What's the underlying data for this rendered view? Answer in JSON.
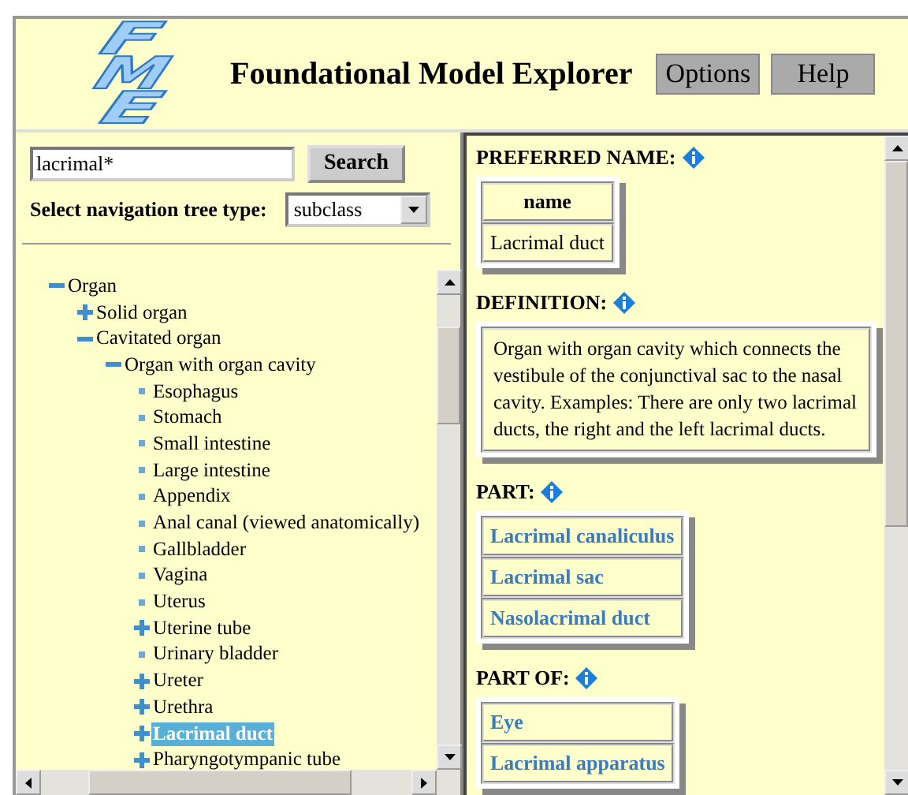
{
  "header": {
    "logo_letters": [
      "F",
      "M",
      "E"
    ],
    "title": "Foundational Model Explorer",
    "buttons": [
      "Options",
      "Help"
    ]
  },
  "search": {
    "value": "lacrimal*",
    "button": "Search",
    "tree_type_label": "Select navigation tree type:",
    "tree_type": "subclass"
  },
  "tree": [
    {
      "label": "Organ",
      "kind": "expanded",
      "selected": false,
      "children": [
        {
          "label": "Solid organ",
          "kind": "collapsed",
          "selected": false
        },
        {
          "label": "Cavitated organ",
          "kind": "expanded",
          "selected": false,
          "children": [
            {
              "label": "Organ with organ cavity",
              "kind": "expanded",
              "selected": false,
              "children": [
                {
                  "label": "Esophagus",
                  "kind": "leaf",
                  "selected": false
                },
                {
                  "label": "Stomach",
                  "kind": "leaf",
                  "selected": false
                },
                {
                  "label": "Small intestine",
                  "kind": "leaf",
                  "selected": false
                },
                {
                  "label": "Large intestine",
                  "kind": "leaf",
                  "selected": false
                },
                {
                  "label": "Appendix",
                  "kind": "leaf",
                  "selected": false
                },
                {
                  "label": "Anal canal (viewed anatomically)",
                  "kind": "leaf",
                  "selected": false
                },
                {
                  "label": "Gallbladder",
                  "kind": "leaf",
                  "selected": false
                },
                {
                  "label": "Vagina",
                  "kind": "leaf",
                  "selected": false
                },
                {
                  "label": "Uterus",
                  "kind": "leaf",
                  "selected": false
                },
                {
                  "label": "Uterine tube",
                  "kind": "collapsed",
                  "selected": false
                },
                {
                  "label": "Urinary bladder",
                  "kind": "leaf",
                  "selected": false
                },
                {
                  "label": "Ureter",
                  "kind": "collapsed",
                  "selected": false
                },
                {
                  "label": "Urethra",
                  "kind": "collapsed",
                  "selected": false
                },
                {
                  "label": "Lacrimal duct",
                  "kind": "collapsed",
                  "selected": true
                },
                {
                  "label": "Pharyngotympanic tube",
                  "kind": "collapsed",
                  "selected": false
                }
              ]
            }
          ]
        }
      ]
    }
  ],
  "details": [
    {
      "heading": "PREFERRED NAME:",
      "kind": "table",
      "column": "name",
      "rows": [
        "Lacrimal duct"
      ]
    },
    {
      "heading": "DEFINITION:",
      "kind": "text",
      "text": "Organ with organ cavity which connects the vestibule of the conjunctival sac to the nasal cavity. Examples: There are only two lacrimal ducts, the right and the left lacrimal ducts."
    },
    {
      "heading": "PART:",
      "kind": "links",
      "rows": [
        "Lacrimal canaliculus",
        "Lacrimal sac",
        "Nasolacrimal duct"
      ]
    },
    {
      "heading": "PART OF:",
      "kind": "links",
      "rows": [
        "Eye",
        "Lacrimal apparatus"
      ]
    }
  ]
}
